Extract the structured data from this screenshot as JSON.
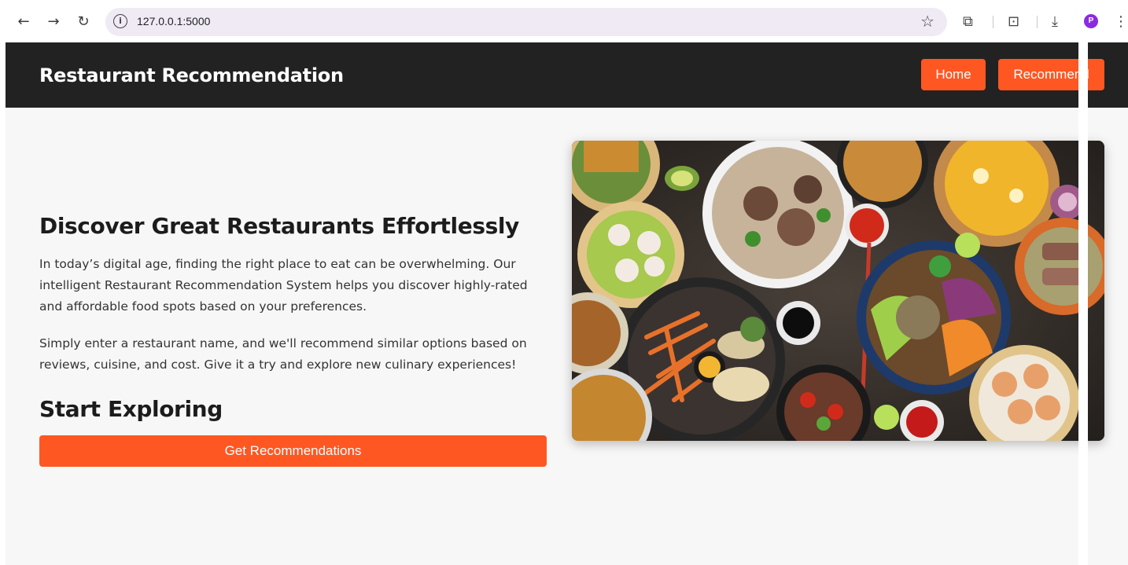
{
  "browser": {
    "url": "127.0.0.1:5000",
    "icons": [
      "back-icon",
      "forward-icon",
      "reload-icon",
      "info-icon",
      "star-icon",
      "extensions-icon",
      "screenshot-icon",
      "download-icon",
      "menu-icon"
    ],
    "profile_initial": "P"
  },
  "header": {
    "brand": "Restaurant Recommendation",
    "nav": [
      {
        "label": "Home"
      },
      {
        "label": "Recommend"
      }
    ]
  },
  "hero": {
    "title": "Discover Great Restaurants Effortlessly",
    "paragraphs": [
      "In today’s digital age, finding the right place to eat can be overwhelming. Our intelligent Restaurant Recommendation System helps you discover highly-rated and affordable food spots based on your preferences.",
      "Simply enter a restaurant name, and we'll recommend similar options based on reviews, cuisine, and cost. Give it a try and explore new culinary experiences!"
    ],
    "subtitle": "Start Exploring",
    "cta_label": "Get Recommendations"
  },
  "colors": {
    "accent": "#ff5722",
    "header_bg": "#222222",
    "page_bg": "#f7f7f7"
  }
}
